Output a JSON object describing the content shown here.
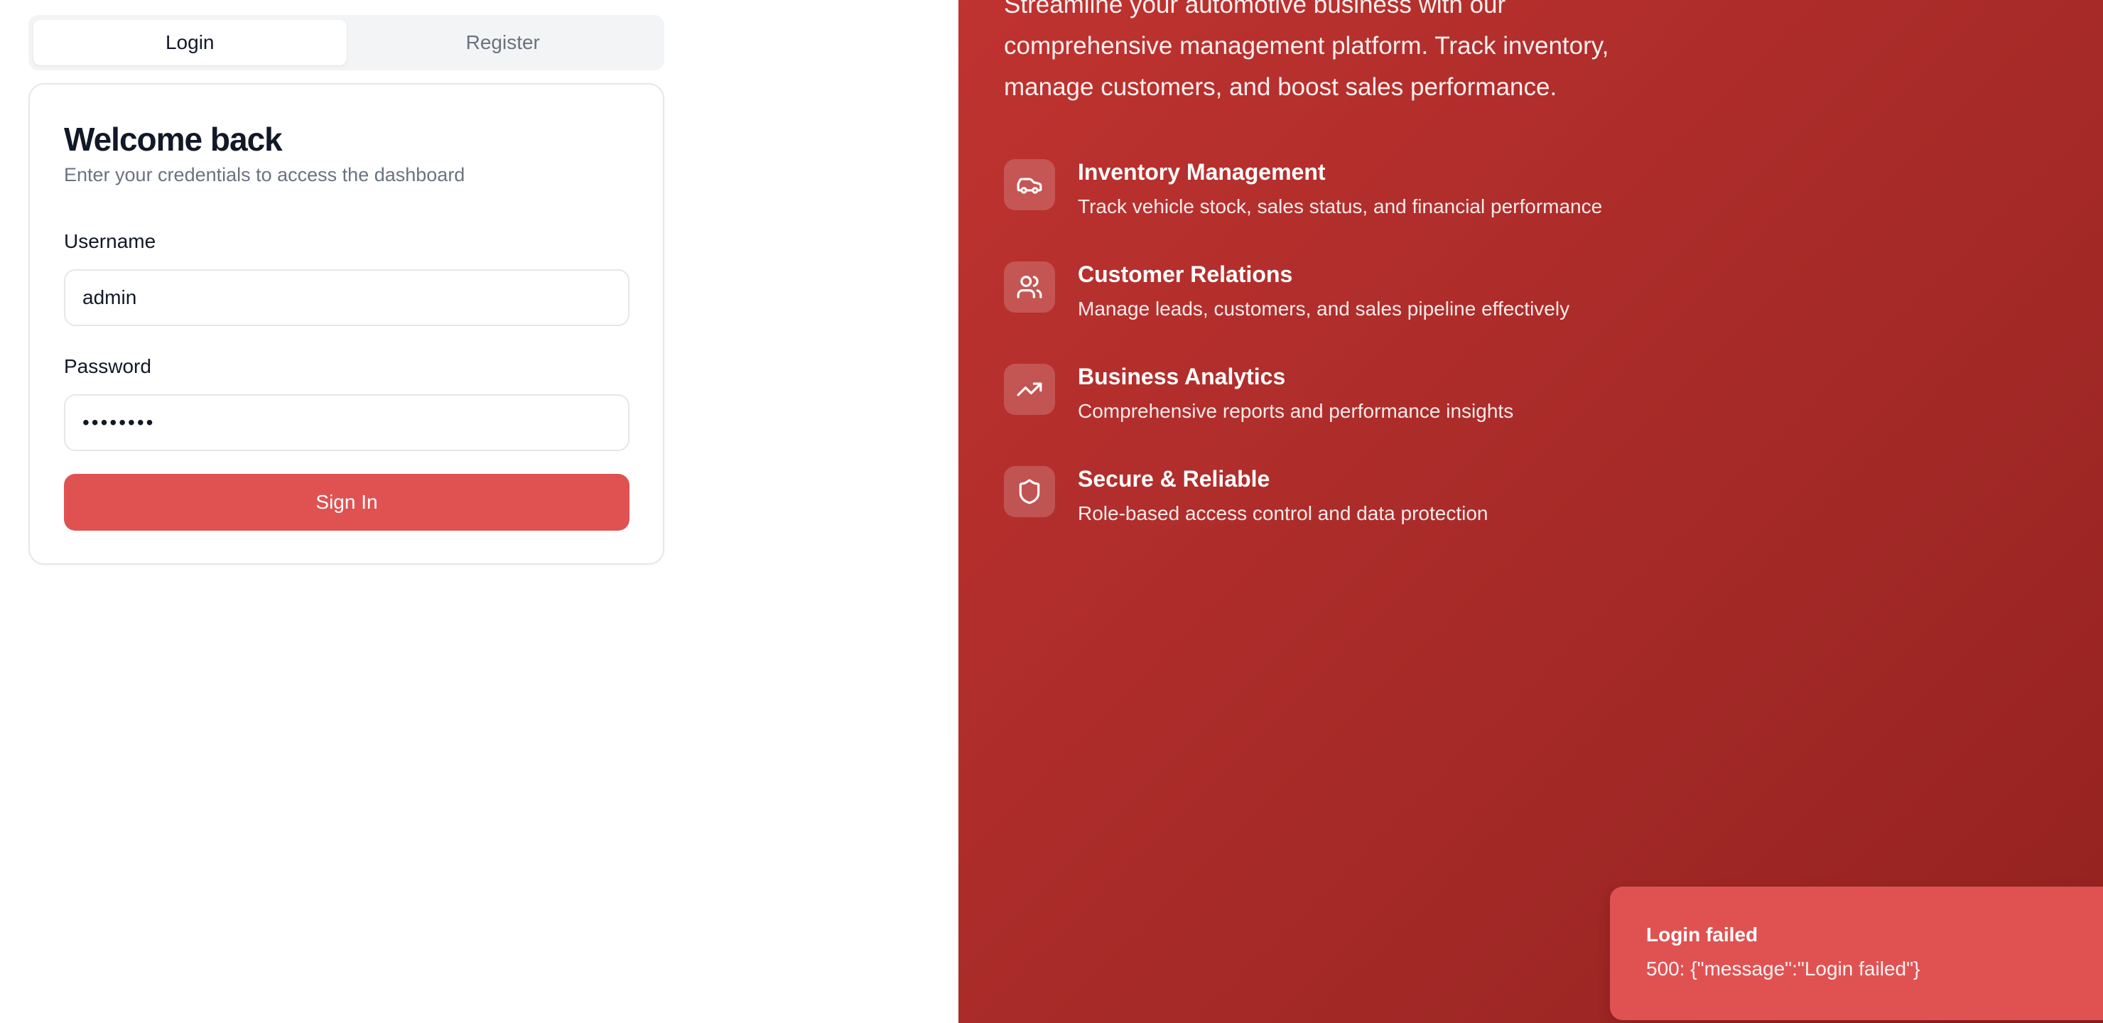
{
  "auth_tabs": {
    "login": "Login",
    "register": "Register"
  },
  "login_card": {
    "title": "Welcome back",
    "subtitle": "Enter your credentials to access the dashboard",
    "username_label": "Username",
    "username_value": "admin",
    "password_label": "Password",
    "password_value": "••••••••",
    "submit_label": "Sign In"
  },
  "hero": {
    "intro": "Streamline your automotive business with our comprehensive management platform. Track inventory, manage customers, and boost sales performance.",
    "features": [
      {
        "icon": "car-icon",
        "title": "Inventory Management",
        "description": "Track vehicle stock, sales status, and financial performance"
      },
      {
        "icon": "users-icon",
        "title": "Customer Relations",
        "description": "Manage leads, customers, and sales pipeline effectively"
      },
      {
        "icon": "trending-up-icon",
        "title": "Business Analytics",
        "description": "Comprehensive reports and performance insights"
      },
      {
        "icon": "shield-icon",
        "title": "Secure & Reliable",
        "description": "Role-based access control and data protection"
      }
    ]
  },
  "toast": {
    "title": "Login failed",
    "message": "500: {\"message\":\"Login failed\"}"
  },
  "colors": {
    "accent": "#e05252",
    "panel_start": "#bf3330",
    "panel_end": "#94221f"
  }
}
